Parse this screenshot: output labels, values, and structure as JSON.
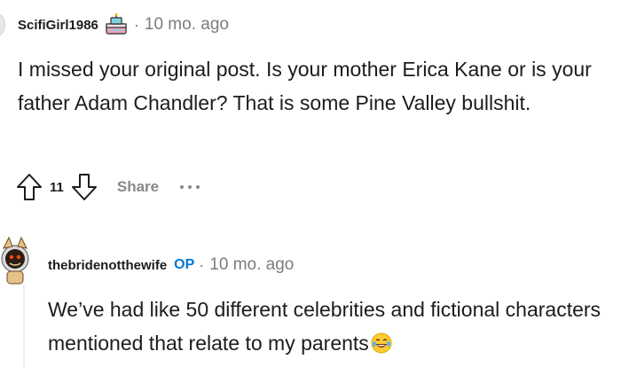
{
  "comments": [
    {
      "username": "ScifiGirl1986",
      "separator": "·",
      "time": "10 mo. ago",
      "body": "I missed your original post. Is your mother Erica Kane or is your father Adam Chandler? That is some Pine Valley bullshit.",
      "votes": "11",
      "share_label": "Share",
      "flair_icon": "cake-icon"
    },
    {
      "username": "thebridenotthewife",
      "op_label": "OP",
      "separator": "·",
      "time": "10 mo. ago",
      "body": "We’ve had like 50 different celebrities and fictional characters mentioned that relate to my parents",
      "emoji_icon": "laughing-tears-emoji-icon"
    }
  ],
  "colors": {
    "text": "#1c1c1c",
    "muted": "#7c7c7c",
    "op_blue": "#0079d3",
    "icon_gray": "#878a8c",
    "thread_line": "#edeff1"
  }
}
